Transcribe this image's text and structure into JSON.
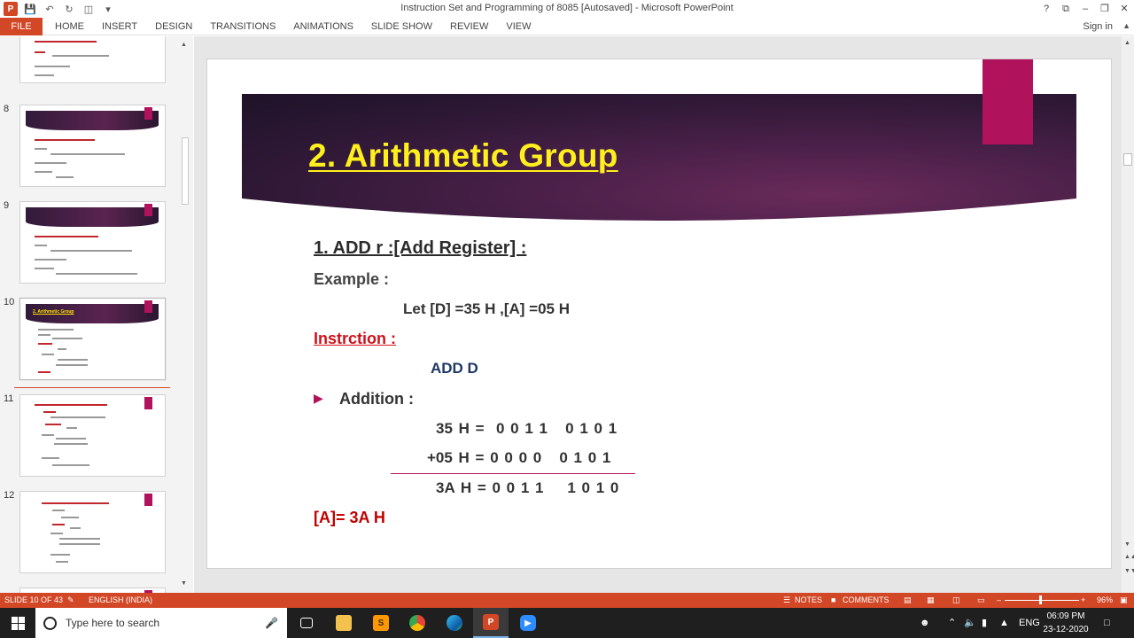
{
  "window": {
    "title": "Instruction Set and Programming of 8085 [Autosaved] - Microsoft PowerPoint",
    "app_logo": "P",
    "controls": [
      "?",
      "⧉",
      "–",
      "❐",
      "✕"
    ]
  },
  "ribbon": {
    "tabs": [
      "FILE",
      "HOME",
      "INSERT",
      "DESIGN",
      "TRANSITIONS",
      "ANIMATIONS",
      "SLIDE SHOW",
      "REVIEW",
      "VIEW"
    ],
    "sign_in": "Sign in"
  },
  "thumbnails": {
    "numbers": [
      "8",
      "9",
      "10",
      "11",
      "12"
    ],
    "slide10_title": "2.  Arithmetic Group"
  },
  "slide": {
    "title": "2.  Arithmetic Group",
    "heading": "1. ADD r :[Add Register] :",
    "example_label": "Example :",
    "let_line": "Let [D] =35 H ,[A] =05 H",
    "instruction_label": "Instrction :",
    "instruction": "ADD D",
    "bullet": "▶",
    "addition_label": "Addition :",
    "row1": "35 H =  0 0 1 1   0 1 0 1",
    "row2": "+05 H = 0 0 0 0   0 1 0 1",
    "row3": "3A H = 0 0 1 1    1 0 1 0",
    "result": "[A]= 3A H"
  },
  "status": {
    "slide_info": "SLIDE 10 OF 43",
    "language": "ENGLISH (INDIA)",
    "notes": "NOTES",
    "comments": "COMMENTS",
    "zoom_minus": "–",
    "zoom_plus": "+",
    "zoom": "96%",
    "zoom_level": 0.48
  },
  "taskbar": {
    "search_placeholder": "Type here to search",
    "lang": "ENG",
    "time": "06:09 PM",
    "date": "23-12-2020"
  },
  "colors": {
    "accent": "#d24726",
    "title_yellow": "#ffef1c",
    "magenta": "#b0125c",
    "red": "#d0111a"
  }
}
